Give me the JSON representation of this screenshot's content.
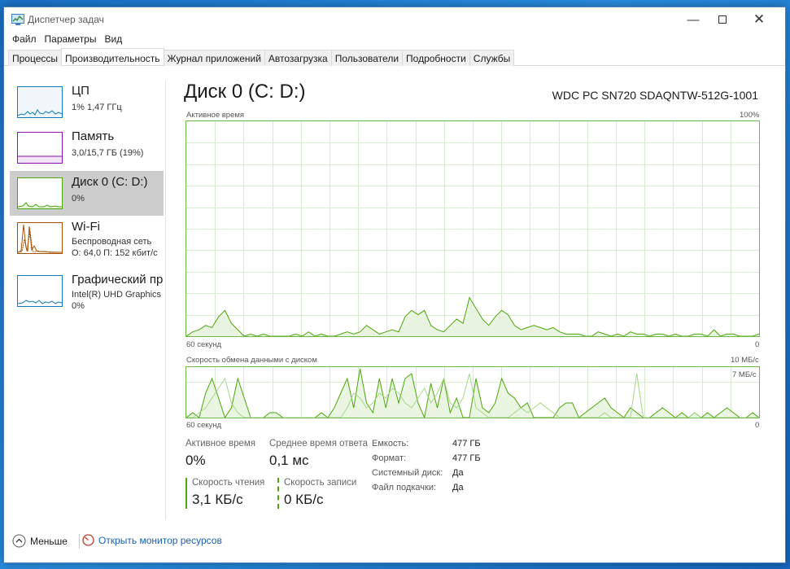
{
  "window": {
    "title": "Диспетчер задач"
  },
  "menu": [
    "Файл",
    "Параметры",
    "Вид"
  ],
  "tabs": [
    "Процессы",
    "Производительность",
    "Журнал приложений",
    "Автозагрузка",
    "Пользователи",
    "Подробности",
    "Службы"
  ],
  "active_tab": "Производительность",
  "sidebar": {
    "items": [
      {
        "title": "ЦП",
        "line1": "1% 1,47 ГГц",
        "line2": "",
        "color": "#117dbb"
      },
      {
        "title": "Память",
        "line1": "3,0/15,7 ГБ (19%)",
        "line2": "",
        "color": "#8b12ae"
      },
      {
        "title": "Диск 0 (C: D:)",
        "line1": "0%",
        "line2": "",
        "color": "#4da60c"
      },
      {
        "title": "Wi-Fi",
        "line1": "Беспроводная сеть",
        "line2": "О: 64,0  П: 152 кбит/с",
        "color": "#a74f01"
      },
      {
        "title": "Графический про",
        "line1": "Intel(R) UHD Graphics",
        "line2": "0%",
        "color": "#117dbb"
      }
    ]
  },
  "main": {
    "title": "Диск 0 (C: D:)",
    "model": "WDC PC SN720 SDAQNTW-512G-1001",
    "chart1": {
      "label": "Активное время",
      "max_label": "100%",
      "time_label": "60 секунд",
      "zero_label": "0"
    },
    "chart2": {
      "label": "Скорость обмена данными с диском",
      "max_label": "10 МБ/с",
      "inner_label": "7 МБ/с",
      "time_label": "60 секунд",
      "zero_label": "0"
    },
    "stats": {
      "active_time_label": "Активное время",
      "active_time_value": "0%",
      "response_label": "Среднее время ответа",
      "response_value": "0,1 мс",
      "read_label": "Скорость чтения",
      "read_value": "3,1 КБ/с",
      "write_label": "Скорость записи",
      "write_value": "0 КБ/с"
    },
    "properties": [
      {
        "label": "Емкость:",
        "value": "477 ГБ"
      },
      {
        "label": "Формат:",
        "value": "477 ГБ"
      },
      {
        "label": "Системный диск:",
        "value": "Да"
      },
      {
        "label": "Файл подкачки:",
        "value": "Да"
      }
    ]
  },
  "footer": {
    "less_label": "Меньше",
    "monitor_link": "Открыть монитор ресурсов"
  },
  "chart_data": [
    {
      "type": "area",
      "title": "Активное время",
      "ylim": [
        0,
        100
      ],
      "x_label": "60 секунд",
      "series": [
        {
          "values": [
            0,
            2,
            3,
            5,
            4,
            9,
            12,
            6,
            3,
            0,
            1,
            0,
            1,
            0,
            0,
            0,
            0,
            1,
            0,
            2,
            0,
            1,
            0,
            0,
            1,
            2,
            1,
            2,
            5,
            3,
            1,
            2,
            3,
            2,
            9,
            12,
            10,
            12,
            5,
            3,
            2,
            5,
            8,
            6,
            18,
            13,
            8,
            5,
            9,
            12,
            10,
            5,
            3,
            4,
            5,
            4,
            3,
            4,
            2,
            1,
            1,
            1,
            0,
            0,
            2,
            1,
            0,
            1,
            0,
            2,
            1,
            1,
            0,
            1,
            1,
            0,
            1,
            0,
            0,
            1,
            1,
            0,
            3,
            0,
            1,
            1,
            0,
            0,
            0,
            1
          ]
        }
      ]
    },
    {
      "type": "line",
      "title": "Скорость обмена данными с диском",
      "ylim": [
        0,
        10
      ],
      "x_label": "60 секунд",
      "series": [
        {
          "values": [
            0,
            1,
            0,
            5,
            8,
            4,
            0,
            2,
            8,
            4,
            0,
            0,
            0,
            1,
            1,
            0,
            0,
            0,
            0,
            0,
            0,
            1,
            0,
            2,
            5,
            8,
            2,
            10,
            3,
            1,
            8,
            2,
            8,
            3,
            8,
            9,
            3,
            0,
            7,
            2,
            8,
            1,
            4,
            0,
            0,
            8,
            2,
            1,
            3,
            8,
            5,
            4,
            2,
            3,
            0,
            0,
            0,
            0,
            2,
            3,
            3,
            0,
            1,
            2,
            3,
            4,
            2,
            1,
            0,
            2,
            1,
            0,
            0,
            1,
            2,
            1,
            0,
            1,
            0,
            1,
            0,
            1,
            0,
            1,
            2,
            1,
            0,
            0,
            1,
            0
          ]
        },
        {
          "values": [
            0,
            0,
            1,
            2,
            4,
            6,
            8,
            3,
            1,
            0,
            0,
            0,
            0,
            0,
            0,
            0,
            0,
            0,
            0,
            0,
            0,
            0,
            0,
            0,
            0,
            2,
            5,
            4,
            2,
            3,
            5,
            4,
            6,
            5,
            3,
            2,
            4,
            6,
            3,
            5,
            8,
            3,
            2,
            4,
            9,
            2,
            1,
            0,
            0,
            0,
            0,
            1,
            2,
            1,
            2,
            3,
            2,
            1,
            0,
            0,
            0,
            0,
            0,
            0,
            0,
            1,
            0,
            0,
            0,
            0,
            9,
            0,
            0,
            0,
            0,
            0,
            0,
            0,
            0,
            1,
            0,
            0,
            0,
            0,
            0,
            0,
            0,
            0,
            0,
            0
          ]
        }
      ]
    }
  ]
}
